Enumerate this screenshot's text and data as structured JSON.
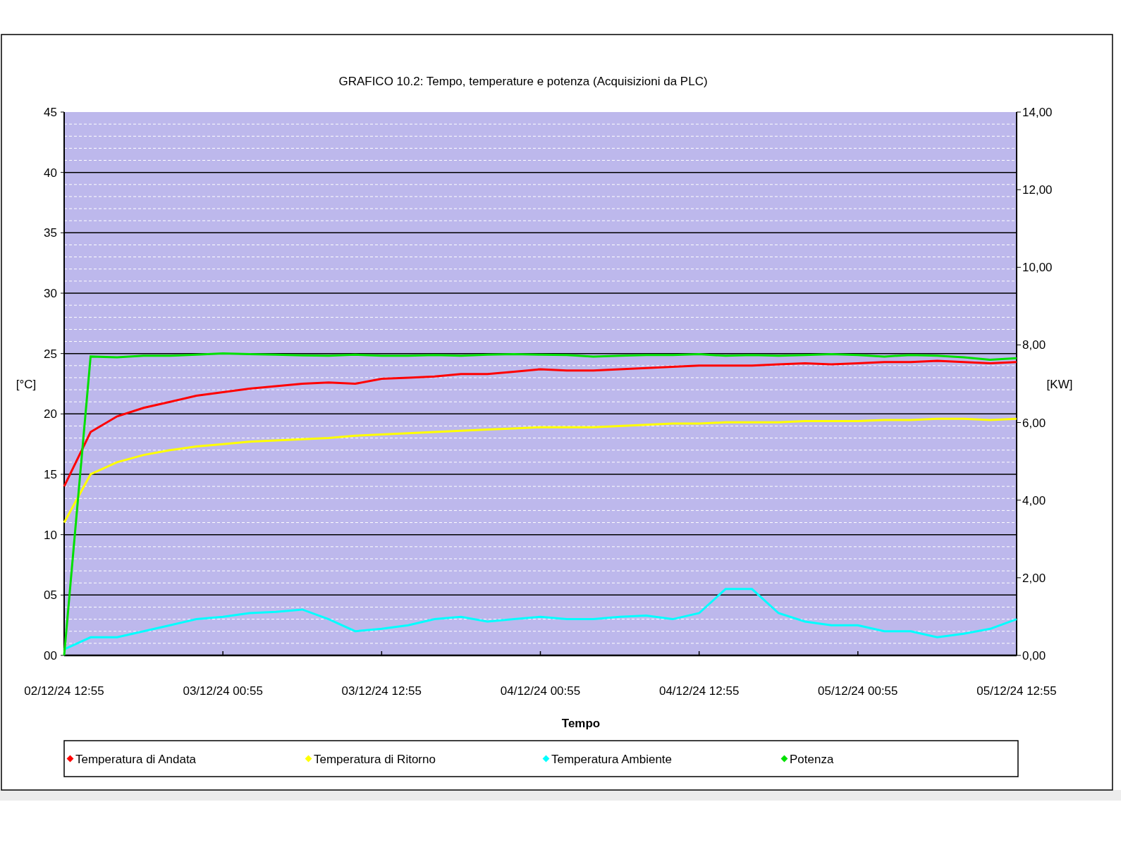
{
  "chart": {
    "chart_data": {
      "type": "line",
      "title": "GRAFICO 10.2: Tempo, temperature e potenza (Acquisizioni da PLC)",
      "xlabel": "Tempo",
      "ylabel": "[°C]",
      "categories": [
        "02/12/24 12:55",
        null,
        null,
        null,
        null,
        null,
        "03/12/24 00:55",
        null,
        null,
        null,
        null,
        null,
        "03/12/24 12:55",
        null,
        null,
        null,
        null,
        null,
        "04/12/24 00:55",
        null,
        null,
        null,
        null,
        null,
        "04/12/24 12:55",
        null,
        null,
        null,
        null,
        null,
        "05/12/24 00:55",
        null,
        null,
        null,
        null,
        null,
        "05/12/24 12:55"
      ],
      "ylim": [
        0,
        45
      ],
      "grid": true,
      "legend": true,
      "y2label": "[KW]",
      "y2lim": [
        0,
        14
      ],
      "y2ticks": [
        {
          "value": 0,
          "label": "0,00"
        },
        {
          "value": 2,
          "label": "2,00"
        },
        {
          "value": 4,
          "label": "4,00"
        },
        {
          "value": 6,
          "label": "6,00"
        },
        {
          "value": 8,
          "label": "8,00"
        },
        {
          "value": 10,
          "label": "10,00"
        },
        {
          "value": 12,
          "label": "12,00"
        },
        {
          "value": 14,
          "label": "14,00"
        }
      ],
      "yticks": [
        {
          "value": 0,
          "label": "00"
        },
        {
          "value": 5,
          "label": "05"
        },
        {
          "value": 10,
          "label": "10"
        },
        {
          "value": 15,
          "label": "15"
        },
        {
          "value": 20,
          "label": "20"
        },
        {
          "value": 25,
          "label": "25"
        },
        {
          "value": 30,
          "label": "30"
        },
        {
          "value": 35,
          "label": "35"
        },
        {
          "value": 40,
          "label": "40"
        },
        {
          "value": 45,
          "label": "45"
        }
      ],
      "series": [
        {
          "name": "Temperatura di Andata",
          "color": "#ff0000",
          "values": [
            14,
            18.5,
            19.8,
            20.5,
            21.0,
            21.5,
            21.8,
            22.1,
            22.3,
            22.5,
            22.6,
            22.5,
            22.9,
            23.0,
            23.1,
            23.3,
            23.3,
            23.5,
            23.7,
            23.6,
            23.6,
            23.7,
            23.8,
            23.9,
            24.0,
            24.0,
            24.0,
            24.1,
            24.2,
            24.1,
            24.2,
            24.3,
            24.3,
            24.4,
            24.3,
            24.2,
            24.3
          ]
        },
        {
          "name": "Temperatura di Ritorno",
          "color": "#ffff00",
          "values": [
            11,
            15,
            16.0,
            16.6,
            17.0,
            17.3,
            17.5,
            17.7,
            17.8,
            17.9,
            18.0,
            18.2,
            18.3,
            18.4,
            18.5,
            18.6,
            18.7,
            18.8,
            18.9,
            18.9,
            18.9,
            19.0,
            19.1,
            19.2,
            19.2,
            19.3,
            19.3,
            19.3,
            19.4,
            19.4,
            19.4,
            19.5,
            19.5,
            19.6,
            19.6,
            19.5,
            19.6
          ]
        },
        {
          "name": "Temperatura Ambiente",
          "color": "#00ffff",
          "values": [
            0.5,
            1.5,
            1.5,
            2.0,
            2.5,
            3.0,
            3.2,
            3.5,
            3.6,
            3.8,
            3.0,
            2.0,
            2.2,
            2.5,
            3.0,
            3.2,
            2.8,
            3.0,
            3.2,
            3.0,
            3.0,
            3.2,
            3.3,
            3.0,
            3.5,
            5.5,
            5.5,
            3.5,
            2.8,
            2.5,
            2.5,
            2.0,
            2.0,
            1.5,
            1.8,
            2.2,
            3.0
          ]
        },
        {
          "name": "Potenza",
          "color": "#00e000",
          "axis": "y2",
          "values": [
            0,
            7.7,
            7.68,
            7.72,
            7.72,
            7.75,
            7.78,
            7.76,
            7.75,
            7.73,
            7.72,
            7.75,
            7.72,
            7.72,
            7.74,
            7.72,
            7.75,
            7.76,
            7.75,
            7.74,
            7.7,
            7.72,
            7.74,
            7.74,
            7.76,
            7.72,
            7.74,
            7.72,
            7.74,
            7.76,
            7.74,
            7.7,
            7.74,
            7.72,
            7.68,
            7.62,
            7.66
          ]
        }
      ]
    }
  }
}
